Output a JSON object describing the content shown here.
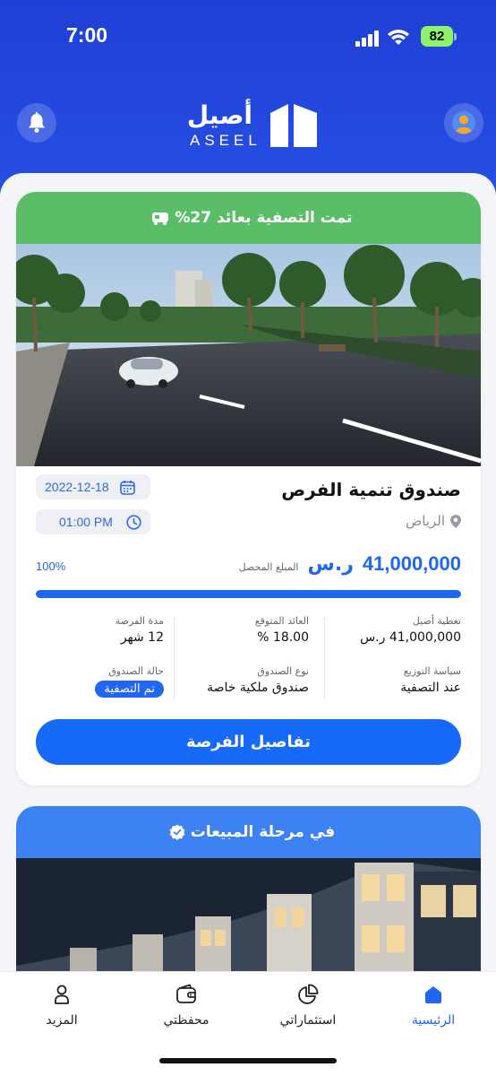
{
  "status_bar": {
    "time": "7:00",
    "battery": "82"
  },
  "header": {
    "logo_ar": "أصيل",
    "logo_en": "ASEEL",
    "icons": [
      "bell-icon",
      "profile-avatar-icon"
    ]
  },
  "card1": {
    "banner": "تمت التصفية بعائد 27%",
    "title": "صندوق تنمية الفرص",
    "location": "الرياض",
    "date": "2022-12-18",
    "time": "01:00 PM",
    "amount": "41,000,000",
    "currency": "ر.س",
    "amount_label": "المبلغ المحصل",
    "percent_text": "100%",
    "progress": 1.0,
    "info": {
      "coverage_label": "تغطية أصيل",
      "coverage_value": "41,000,000 ر.س",
      "expected_return_label": "العائد المتوقع",
      "expected_return_value": "18.00 %",
      "duration_label": "مدة الفرصة",
      "duration_value": "12 شهر",
      "distribution_label": "سياسة التوزيع",
      "distribution_value": "عند التصفية",
      "fund_type_label": "نوع الصندوق",
      "fund_type_value": "صندوق ملكية خاصة",
      "fund_status_label": "حالة الصندوق",
      "fund_status_value": "تم التصفية"
    },
    "details_button": "تفاصيل الفرصة"
  },
  "card2": {
    "banner": "في مرحلة المبيعات"
  },
  "nav": {
    "home": "الرئيسية",
    "investments": "استثماراتي",
    "wallet": "محفظتي",
    "more": "المزيد"
  },
  "colors": {
    "primary": "#1f66f0",
    "header_bg": "#2447dd",
    "green_banner": "#5cbd69",
    "blue_banner": "#3d82f2"
  }
}
